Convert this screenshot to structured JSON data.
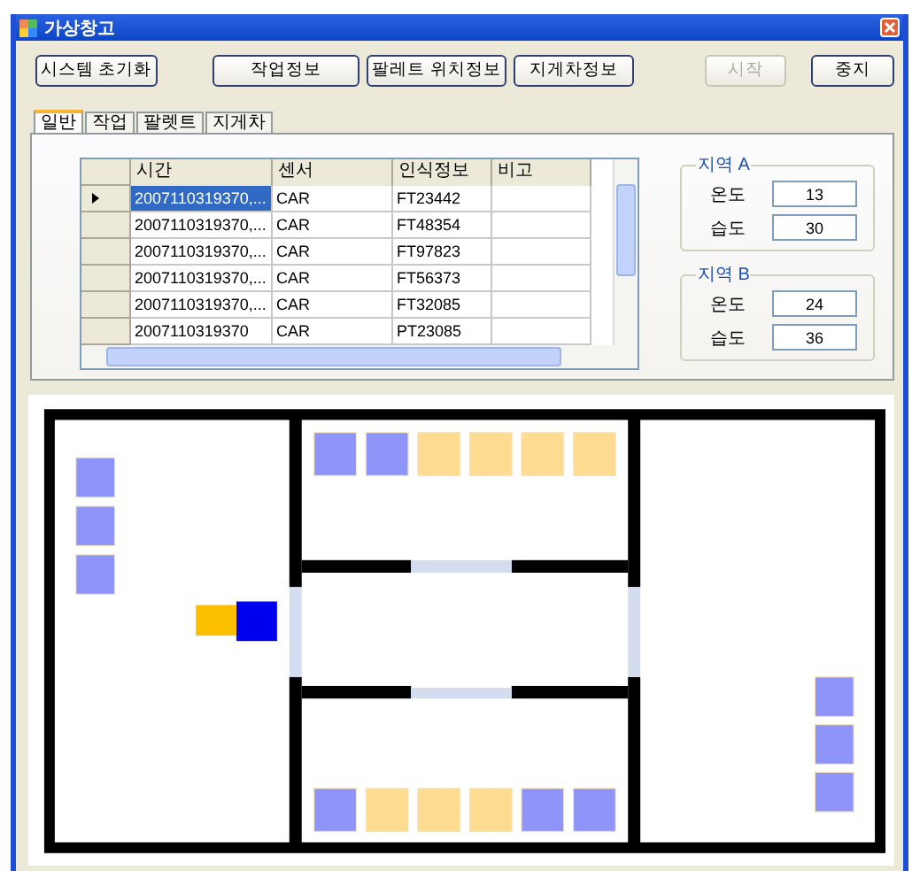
{
  "window": {
    "title": "가상창고"
  },
  "toolbar": [
    {
      "label": "시스템 초기화",
      "disabled": false
    },
    {
      "label": "작업정보",
      "disabled": false
    },
    {
      "label": "팔레트 위치정보",
      "disabled": false
    },
    {
      "label": "지게차정보",
      "disabled": false
    },
    {
      "label": "시작",
      "disabled": true
    },
    {
      "label": "중지",
      "disabled": false
    }
  ],
  "tabs": [
    {
      "label": "일반",
      "selected": true
    },
    {
      "label": "작업",
      "selected": false
    },
    {
      "label": "팔렛트",
      "selected": false
    },
    {
      "label": "지게차",
      "selected": false
    }
  ],
  "table": {
    "columns": [
      "시간",
      "센서",
      "인식정보",
      "비고"
    ],
    "rows": [
      {
        "cells": [
          "2007110319370,...",
          "CAR",
          "FT23442",
          ""
        ],
        "selected": true
      },
      {
        "cells": [
          "2007110319370,...",
          "CAR",
          "FT48354",
          ""
        ],
        "selected": false
      },
      {
        "cells": [
          "2007110319370,...",
          "CAR",
          "FT97823",
          ""
        ],
        "selected": false
      },
      {
        "cells": [
          "2007110319370,...",
          "CAR",
          "FT56373",
          ""
        ],
        "selected": false
      },
      {
        "cells": [
          "2007110319370,...",
          "CAR",
          "FT32085",
          ""
        ],
        "selected": false
      },
      {
        "cells": [
          "2007110319370",
          "CAR",
          "PT23085",
          ""
        ],
        "selected": false
      }
    ]
  },
  "zones": [
    {
      "title": "지역 A",
      "fields": [
        {
          "label": "온도",
          "value": "13"
        },
        {
          "label": "습도",
          "value": "30"
        }
      ]
    },
    {
      "title": "지역 B",
      "fields": [
        {
          "label": "온도",
          "value": "24"
        },
        {
          "label": "습도",
          "value": "36"
        }
      ]
    }
  ],
  "map": {
    "top_row": [
      {
        "color": "#8f94f8"
      },
      {
        "color": "#8f94f8"
      },
      {
        "color": "#fddb91"
      },
      {
        "color": "#fddb91"
      },
      {
        "color": "#fddb91"
      },
      {
        "color": "#fddb91"
      }
    ],
    "bottom_row": [
      {
        "color": "#8f94f8"
      },
      {
        "color": "#fddb91"
      },
      {
        "color": "#fddb91"
      },
      {
        "color": "#fddb91"
      },
      {
        "color": "#8f94f8"
      },
      {
        "color": "#8f94f8"
      }
    ],
    "left_column": [
      {
        "color": "#8f94f8"
      },
      {
        "color": "#8f94f8"
      },
      {
        "color": "#8f94f8"
      }
    ],
    "right_column": [
      {
        "color": "#8f94f8"
      },
      {
        "color": "#8f94f8"
      },
      {
        "color": "#8f94f8"
      }
    ]
  }
}
